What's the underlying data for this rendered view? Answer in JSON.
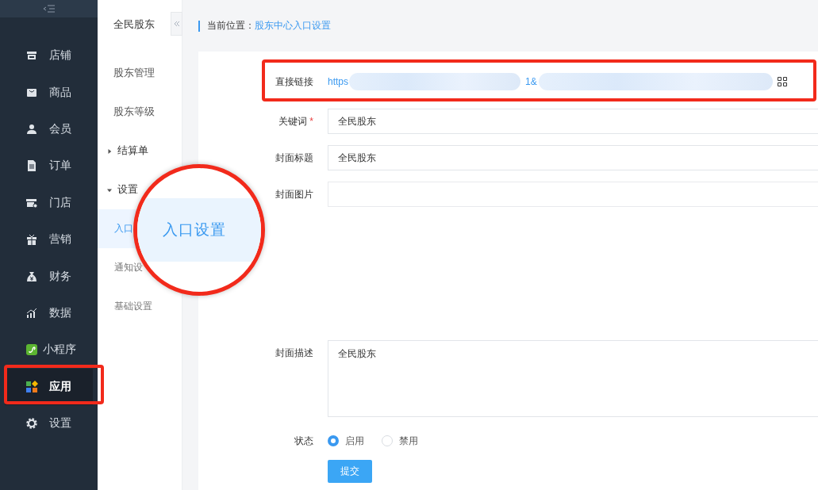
{
  "sidebar": {
    "items": [
      {
        "label": "店铺",
        "selected": false
      },
      {
        "label": "商品",
        "selected": false
      },
      {
        "label": "会员",
        "selected": false
      },
      {
        "label": "订单",
        "selected": false
      },
      {
        "label": "门店",
        "selected": false
      },
      {
        "label": "营销",
        "selected": false
      },
      {
        "label": "财务",
        "selected": false
      },
      {
        "label": "数据",
        "selected": false
      },
      {
        "label": "小程序",
        "selected": false
      },
      {
        "label": "应用",
        "selected": true
      },
      {
        "label": "设置",
        "selected": false
      }
    ]
  },
  "subnav": {
    "title": "全民股东",
    "items": [
      {
        "label": "股东管理",
        "kind": "link",
        "selected": false
      },
      {
        "label": "股东等级",
        "kind": "link",
        "selected": false
      },
      {
        "label": "结算单",
        "kind": "group",
        "expanded": false,
        "selected": false
      },
      {
        "label": "设置",
        "kind": "group",
        "expanded": true,
        "selected": false
      },
      {
        "label": "入口",
        "kind": "child",
        "selected": true
      },
      {
        "label": "通知设",
        "kind": "child",
        "selected": false
      },
      {
        "label": "基础设置",
        "kind": "child",
        "selected": false
      }
    ]
  },
  "magnifier": {
    "text": "入口设置"
  },
  "breadcrumb": {
    "prefix": "当前位置：",
    "current": "股东中心入口设置"
  },
  "form": {
    "fields": [
      {
        "kind": "link",
        "label": "直接链接",
        "start": "https",
        "middle": "1&"
      },
      {
        "kind": "text",
        "label": "关键词",
        "required": true,
        "value": "全民股东"
      },
      {
        "kind": "text",
        "label": "封面标题",
        "required": false,
        "value": "全民股东"
      },
      {
        "kind": "image",
        "label": "封面图片"
      },
      {
        "kind": "textarea",
        "label": "封面描述",
        "value": "全民股东"
      },
      {
        "kind": "radio",
        "label": "状态",
        "options": [
          {
            "label": "启用",
            "selected": true
          },
          {
            "label": "禁用",
            "selected": false
          }
        ]
      }
    ],
    "required_marker": "*",
    "submit": "提交"
  }
}
